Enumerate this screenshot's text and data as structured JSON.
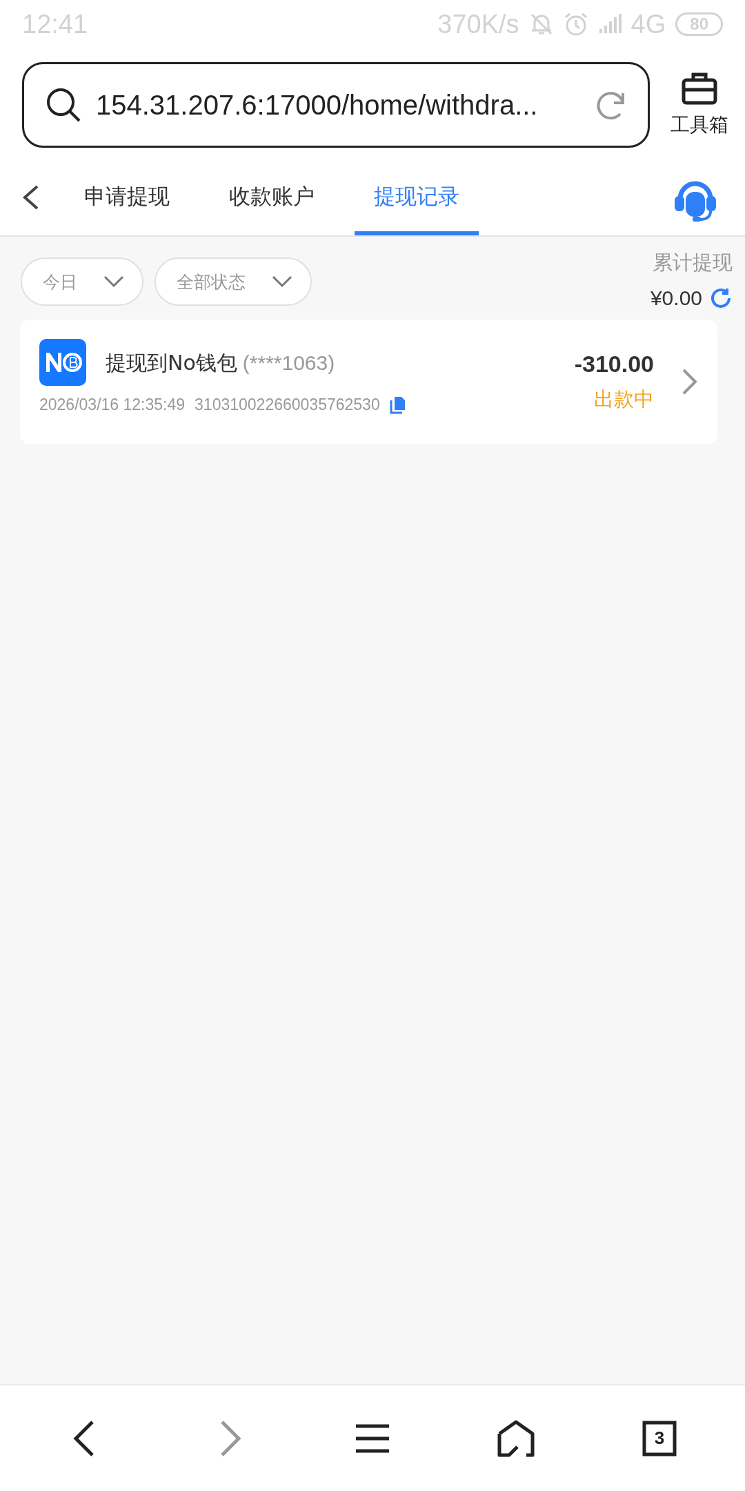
{
  "status_bar": {
    "time": "12:41",
    "speed": "370K/s",
    "network": "4G",
    "battery": "80"
  },
  "address_bar": {
    "url": "154.31.207.6:17000/home/withdra..."
  },
  "toolbox": {
    "label": "工具箱"
  },
  "tabs": [
    {
      "label": "申请提现",
      "selected": false
    },
    {
      "label": "收款账户",
      "selected": false
    },
    {
      "label": "提现记录",
      "selected": true
    }
  ],
  "filters": [
    {
      "label": "今日"
    },
    {
      "label": "全部状态"
    }
  ],
  "total": {
    "label": "累计提现",
    "amount": "¥0.00"
  },
  "records": [
    {
      "title": "提现到No钱包",
      "account": "(****1063)",
      "time": "2026/03/16 12:35:49",
      "order_no": "310310022660035762530",
      "amount": "-310.00",
      "status": "出款中"
    }
  ],
  "nav": [
    {
      "kind": "back",
      "disabled": false
    },
    {
      "kind": "forward",
      "disabled": true
    },
    {
      "kind": "menu",
      "disabled": false
    },
    {
      "kind": "home",
      "disabled": false
    },
    {
      "kind": "tabs",
      "disabled": false,
      "count": "3"
    }
  ]
}
